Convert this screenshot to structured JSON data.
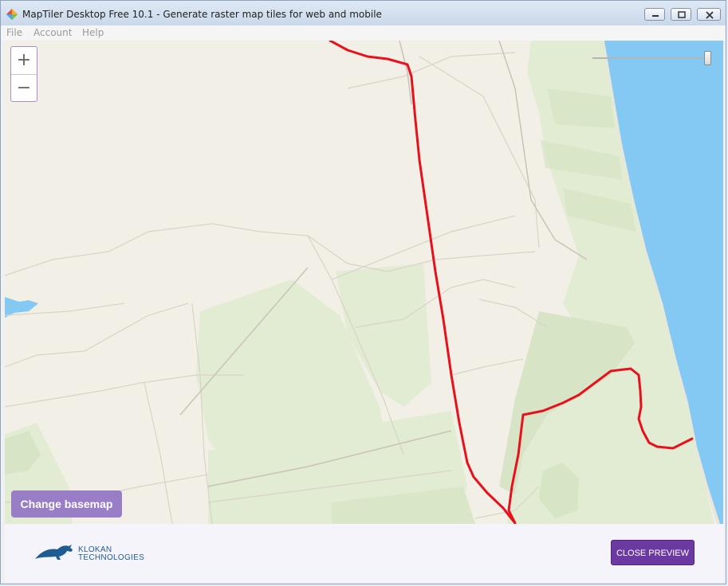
{
  "window": {
    "title": "MapTiler Desktop Free 10.1 - Generate raster map tiles for web and mobile"
  },
  "menu": {
    "items": [
      {
        "label": "File"
      },
      {
        "label": "Account"
      },
      {
        "label": "Help"
      }
    ]
  },
  "map": {
    "zoom_in_label": "+",
    "zoom_out_label": "−",
    "change_basemap_label": "Change basemap",
    "opacity_level": 1.0,
    "colors": {
      "land": "#f2efe6",
      "park": "#e2ecd2",
      "water": "#84c9f4",
      "route": "#e8111b",
      "road": "#d8d3c8"
    }
  },
  "footer": {
    "logo_line1": "KLOKAN",
    "logo_line2": "TECHNOLOGIES",
    "close_preview_label": "CLOSE PREVIEW"
  },
  "colors": {
    "accent": "#6a3aa2",
    "basemap_button": "#9a7dc7"
  }
}
